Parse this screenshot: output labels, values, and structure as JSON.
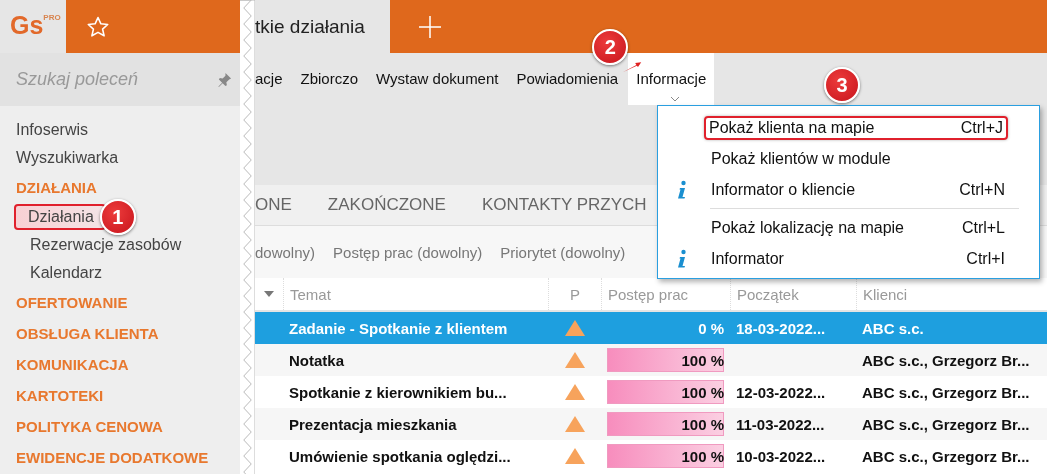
{
  "logo": {
    "text": "Gs",
    "superscript": "PRO"
  },
  "search": {
    "placeholder": "Szukaj poleceń"
  },
  "sidebar": {
    "items": [
      {
        "kind": "link",
        "label": "Infoserwis"
      },
      {
        "kind": "link",
        "label": "Wyszukiwarka"
      },
      {
        "kind": "section",
        "label": "DZIAŁANIA",
        "children": [
          {
            "label": "Działania",
            "selected": true,
            "annotation": "1"
          },
          {
            "label": "Rezerwacje zasobów",
            "selected": false
          },
          {
            "label": "Kalendarz",
            "selected": false
          }
        ]
      },
      {
        "kind": "section",
        "label": "OFERTOWANIE"
      },
      {
        "kind": "section",
        "label": "OBSŁUGA KLIENTA"
      },
      {
        "kind": "section",
        "label": "KOMUNIKACJA"
      },
      {
        "kind": "section",
        "label": "KARTOTEKI"
      },
      {
        "kind": "section",
        "label": "POLITYKA CENOWA"
      },
      {
        "kind": "section",
        "label": "EWIDENCJE DODATKOWE"
      }
    ]
  },
  "document_tab": {
    "label": "tkie działania"
  },
  "ribbon": {
    "tabs": [
      {
        "label": "acje",
        "selected": false
      },
      {
        "label": "Zbiorczo",
        "selected": false
      },
      {
        "label": "Wystaw dokument",
        "selected": false
      },
      {
        "label": "Powiadomienia",
        "selected": false
      },
      {
        "label": "Informacje",
        "selected": true,
        "annotation": "2"
      }
    ]
  },
  "menu": {
    "groups": [
      [
        {
          "label": "Pokaż klienta na mapie",
          "shortcut": "Ctrl+J",
          "info_icon": false,
          "annotation": "3"
        },
        {
          "label": "Pokaż klientów w module",
          "info_icon": false
        },
        {
          "label": "Informator o kliencie",
          "shortcut": "Ctrl+N",
          "info_icon": true
        }
      ],
      [
        {
          "label": "Pokaż lokalizację na mapie",
          "shortcut": "Ctrl+L",
          "info_icon": false
        },
        {
          "label": "Informator",
          "shortcut": "Ctrl+I",
          "info_icon": true
        }
      ]
    ]
  },
  "status_tabs": [
    "ONE",
    "ZAKOŃCZONE",
    "KONTAKTY PRZYCH"
  ],
  "filters": [
    "dowolny)",
    "Postęp prac (dowolny)",
    "Priorytet (dowolny)"
  ],
  "table": {
    "columns": [
      "Temat",
      "P",
      "Postęp prac",
      "Początek",
      "Klienci"
    ],
    "rows": [
      {
        "selected": true,
        "temat": "Zadanie - Spotkanie z klientem",
        "progress": "0 %",
        "start": "18-03-2022...",
        "clients": "ABC s.c."
      },
      {
        "selected": false,
        "temat": "Notatka",
        "level": 1,
        "progress": "100 %",
        "clients": "ABC s.c., Grzegorz Br..."
      },
      {
        "selected": false,
        "temat": "Spotkanie z kierownikiem bu...",
        "level": 1,
        "progress": "100 %",
        "start": "12-03-2022...",
        "clients": "ABC s.c., Grzegorz Br..."
      },
      {
        "selected": false,
        "temat": "Prezentacja mieszkania",
        "level": 1,
        "progress": "100 %",
        "start": "11-03-2022...",
        "clients": "ABC s.c., Grzegorz Br..."
      },
      {
        "selected": false,
        "temat": "Umówienie spotkania oględzi...",
        "level": 1,
        "progress": "100 %",
        "start": "10-03-2022...",
        "clients": "ABC s.c., Grzegorz Br..."
      }
    ]
  }
}
